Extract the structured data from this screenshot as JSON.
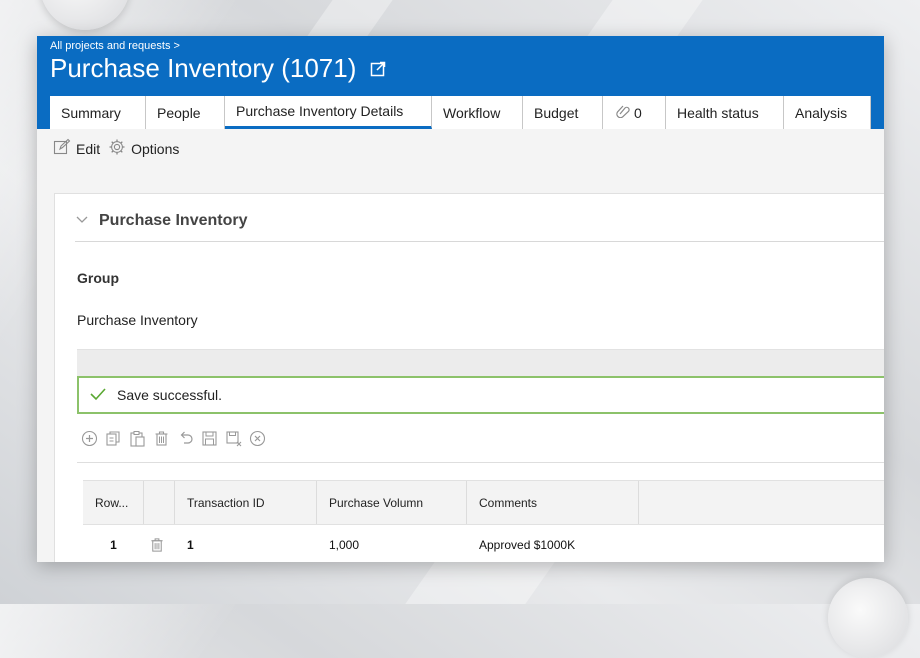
{
  "breadcrumb": "All projects and requests >",
  "page_title": "Purchase Inventory (1071)",
  "tabs": [
    {
      "label": "Summary",
      "active": false
    },
    {
      "label": "People",
      "active": false
    },
    {
      "label": "Purchase Inventory Details",
      "active": true
    },
    {
      "label": "Workflow",
      "active": false
    },
    {
      "label": "Budget",
      "active": false
    },
    {
      "label": "0",
      "active": false,
      "icon": "link-icon"
    },
    {
      "label": "Health status",
      "active": false
    },
    {
      "label": "Analysis",
      "active": false
    }
  ],
  "toolbar": {
    "edit_label": "Edit",
    "options_label": "Options"
  },
  "section": {
    "title": "Purchase Inventory",
    "group_label": "Group",
    "group_value": "Purchase Inventory"
  },
  "message": {
    "text": "Save successful."
  },
  "grid_tool_icons": [
    "add-icon",
    "copy-icon",
    "paste-icon",
    "delete-icon",
    "undo-icon",
    "save-icon",
    "save-close-icon",
    "cancel-icon"
  ],
  "table": {
    "headers": [
      "Row...",
      "",
      "Transaction ID",
      "Purchase Volumn",
      "Comments",
      ""
    ],
    "rows": [
      {
        "row": "1",
        "transaction_id": "1",
        "purchase_volume": "1,000",
        "comments": "Approved $1000K"
      }
    ]
  },
  "colors": {
    "header_blue": "#0a6cc2",
    "success_border": "#8cc26a",
    "success_check": "#5aa832"
  }
}
